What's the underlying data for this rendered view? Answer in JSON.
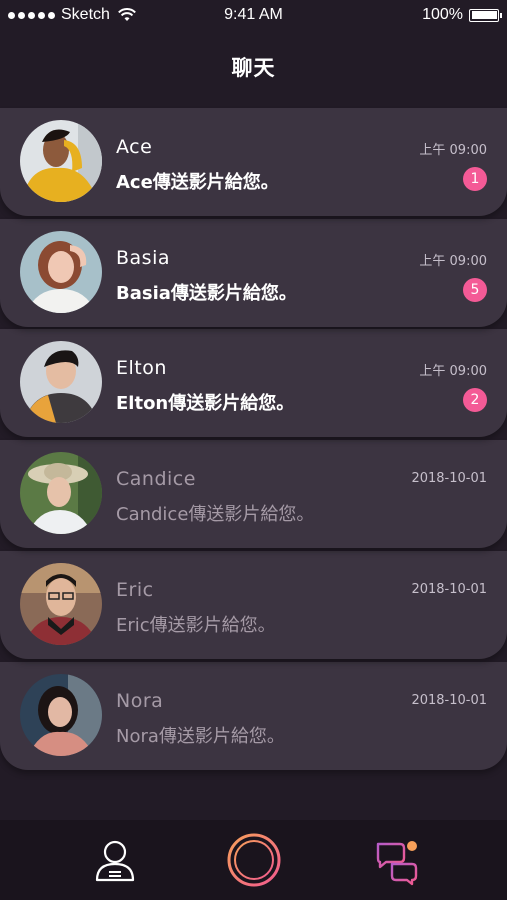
{
  "status_bar": {
    "carrier": "Sketch",
    "time": "9:41 AM",
    "battery": "100%"
  },
  "header": {
    "title": "聊天"
  },
  "chats": [
    {
      "name": "Ace",
      "message": "Ace傳送影片給您。",
      "time": "上午 09:00",
      "badge": "1",
      "read": false
    },
    {
      "name": "Basia",
      "message": "Basia傳送影片給您。",
      "time": "上午 09:00",
      "badge": "5",
      "read": false
    },
    {
      "name": "Elton",
      "message": "Elton傳送影片給您。",
      "time": "上午 09:00",
      "badge": "2",
      "read": false
    },
    {
      "name": "Candice",
      "message": "Candice傳送影片給您。",
      "time": "2018-10-01",
      "badge": null,
      "read": true
    },
    {
      "name": "Eric",
      "message": "Eric傳送影片給您。",
      "time": "2018-10-01",
      "badge": null,
      "read": true
    },
    {
      "name": "Nora",
      "message": "Nora傳送影片給您。",
      "time": "2018-10-01",
      "badge": null,
      "read": true
    }
  ],
  "tab_bar": {
    "items": [
      {
        "icon": "profile-icon"
      },
      {
        "icon": "home-ring-icon"
      },
      {
        "icon": "chat-icon"
      }
    ]
  },
  "colors": {
    "background": "#221b26",
    "card": "#3c3441",
    "badge": "#f45a96",
    "accent_gradient_start": "#f25a8e",
    "accent_gradient_end": "#f7a05a"
  }
}
